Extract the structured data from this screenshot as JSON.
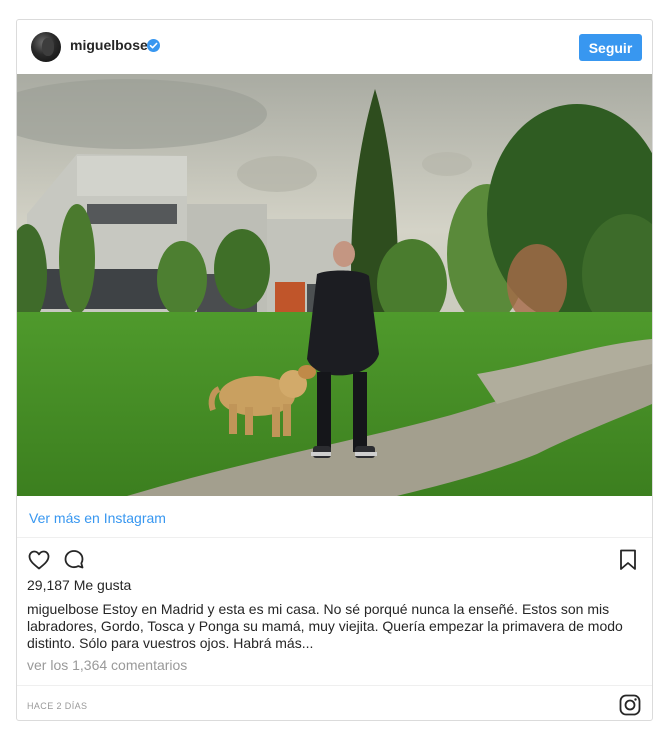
{
  "header": {
    "username": "miguelbose",
    "follow_label": "Seguir",
    "verified": true
  },
  "photo": {
    "alt": "miguelbose"
  },
  "view_more": "Ver más en Instagram",
  "actions": {
    "like_icon": "heart-icon",
    "comment_icon": "comment-icon",
    "save_icon": "bookmark-icon"
  },
  "likes": "29,187 Me gusta",
  "caption": {
    "user": "miguelbose",
    "text": "Estoy en Madrid y esta es mi casa. No sé porqué nunca la enseñé. Estos son mis labradores, Gordo, Tosca y Ponga su mamá, muy viejita. Quería empezar la primavera de modo distinto. Sólo para vuestros ojos. Habrá más..."
  },
  "comments": "ver los 1,364 comentarios",
  "timestamp": "HACE 2 DÍAS",
  "colors": {
    "accent": "#3897f0",
    "text": "#262626",
    "muted": "#999999",
    "border": "#dbdbdb"
  }
}
